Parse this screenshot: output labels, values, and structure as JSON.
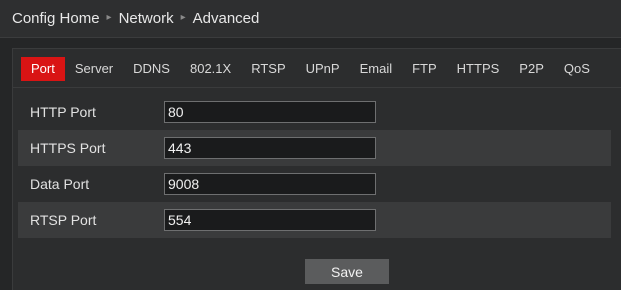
{
  "breadcrumb": {
    "items": [
      "Config Home",
      "Network",
      "Advanced"
    ],
    "separator": "▸"
  },
  "tabs": [
    {
      "label": "Port",
      "active": true
    },
    {
      "label": "Server",
      "active": false
    },
    {
      "label": "DDNS",
      "active": false
    },
    {
      "label": "802.1X",
      "active": false
    },
    {
      "label": "RTSP",
      "active": false
    },
    {
      "label": "UPnP",
      "active": false
    },
    {
      "label": "Email",
      "active": false
    },
    {
      "label": "FTP",
      "active": false
    },
    {
      "label": "HTTPS",
      "active": false
    },
    {
      "label": "P2P",
      "active": false
    },
    {
      "label": "QoS",
      "active": false
    }
  ],
  "form": {
    "fields": [
      {
        "label": "HTTP Port",
        "value": "80"
      },
      {
        "label": "HTTPS Port",
        "value": "443"
      },
      {
        "label": "Data Port",
        "value": "9008"
      },
      {
        "label": "RTSP Port",
        "value": "554"
      }
    ],
    "save_label": "Save"
  },
  "colors": {
    "active_tab": "#d91414",
    "background": "#252627",
    "alt_row": "#3a3b3c",
    "button": "#5b5c5d"
  }
}
